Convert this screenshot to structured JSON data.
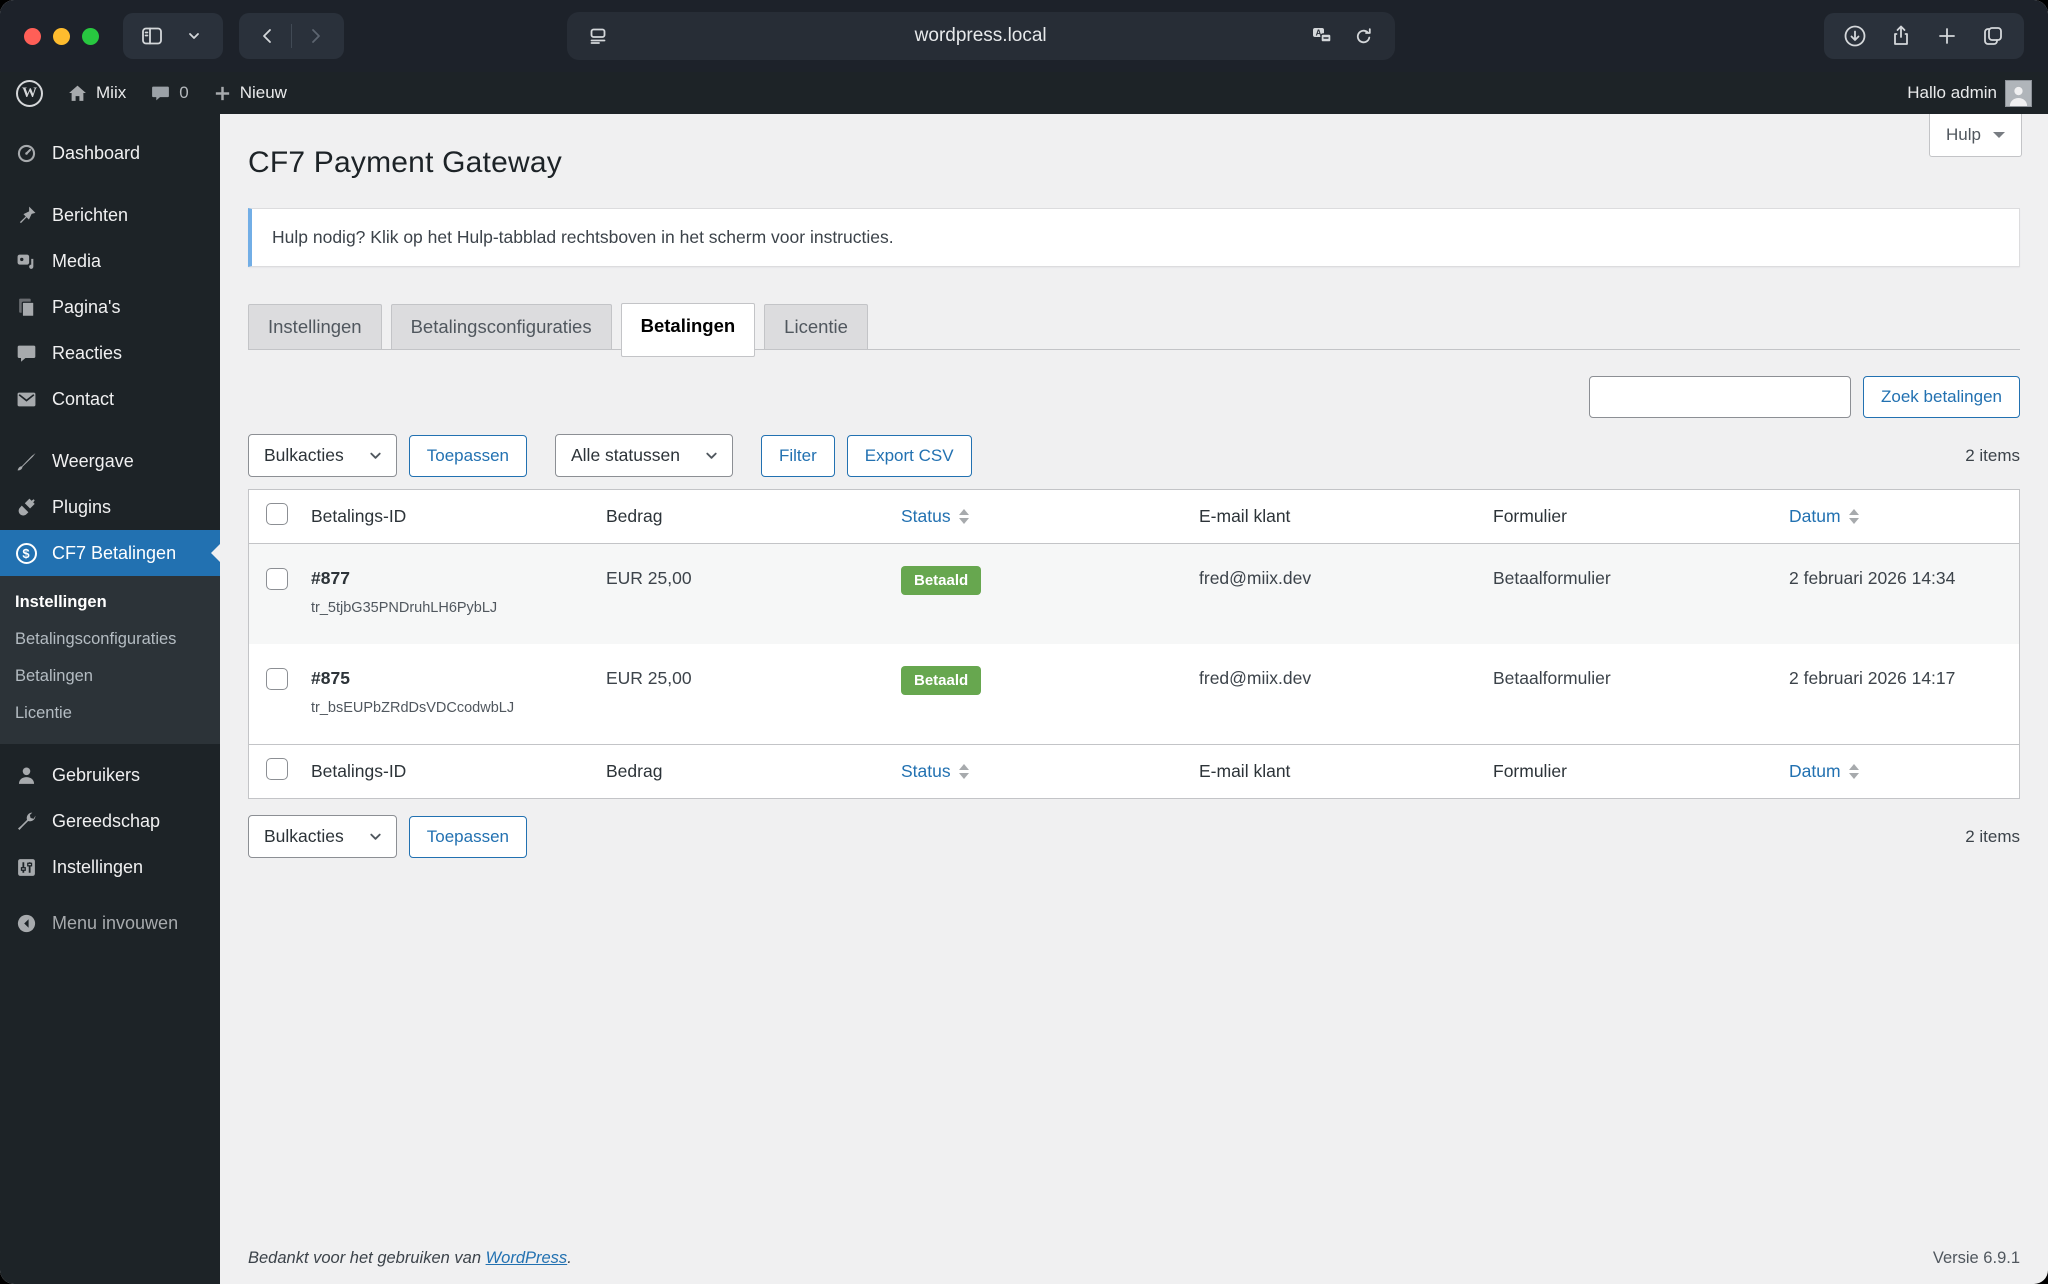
{
  "colors": {
    "accent_blue": "#2271b1",
    "badge_green": "#67a74f",
    "notice_blue": "#72aee6",
    "admin_dark": "#1d2327",
    "traffic_red": "#ff5f57",
    "traffic_yellow": "#febc2e",
    "traffic_green": "#28c840"
  },
  "icons": {
    "wp_logo_glyph": "W",
    "dollar_glyph": "$",
    "translate_glyph": "A"
  },
  "browser": {
    "url": "wordpress.local"
  },
  "admin_bar": {
    "site_name": "Miix",
    "comments_count": "0",
    "new_label": "Nieuw",
    "greeting": "Hallo admin"
  },
  "sidebar": {
    "items": [
      {
        "label": "Dashboard"
      },
      {
        "label": "Berichten"
      },
      {
        "label": "Media"
      },
      {
        "label": "Pagina's"
      },
      {
        "label": "Reacties"
      },
      {
        "label": "Contact"
      },
      {
        "label": "Weergave"
      },
      {
        "label": "Plugins"
      },
      {
        "label": "CF7 Betalingen",
        "active": true
      },
      {
        "label": "Gebruikers"
      },
      {
        "label": "Gereedschap"
      },
      {
        "label": "Instellingen"
      }
    ],
    "submenu": [
      {
        "label": "Instellingen",
        "current": true
      },
      {
        "label": "Betalingsconfiguraties"
      },
      {
        "label": "Betalingen"
      },
      {
        "label": "Licentie"
      }
    ],
    "collapse_label": "Menu invouwen"
  },
  "page": {
    "title": "CF7 Payment Gateway",
    "help_label": "Hulp",
    "notice": "Hulp nodig? Klik op het Hulp-tabblad rechtsboven in het scherm voor instructies.",
    "tabs": [
      {
        "label": "Instellingen"
      },
      {
        "label": "Betalingsconfiguraties"
      },
      {
        "label": "Betalingen",
        "active": true
      },
      {
        "label": "Licentie"
      }
    ],
    "search_button": "Zoek betalingen",
    "items_count": "2 items",
    "toolbar": {
      "bulk_actions": "Bulkacties",
      "apply": "Toepassen",
      "all_statuses": "Alle statussen",
      "filter": "Filter",
      "export_csv": "Export CSV"
    },
    "table": {
      "headers": {
        "id": "Betalings-ID",
        "amount": "Bedrag",
        "status": "Status",
        "email": "E-mail klant",
        "form": "Formulier",
        "date": "Datum"
      },
      "rows": [
        {
          "id": "#877",
          "transaction": "tr_5tjbG35PNDruhLH6PybLJ",
          "amount": "EUR 25,00",
          "status": "Betaald",
          "email": "fred@miix.dev",
          "form": "Betaalformulier",
          "date": "2 februari 2026 14:34"
        },
        {
          "id": "#875",
          "transaction": "tr_bsEUPbZRdDsVDCcodwbLJ",
          "amount": "EUR 25,00",
          "status": "Betaald",
          "email": "fred@miix.dev",
          "form": "Betaalformulier",
          "date": "2 februari 2026 14:17"
        }
      ]
    },
    "footer": {
      "thanks_prefix": "Bedankt voor het gebruiken van ",
      "link_label": "WordPress",
      "thanks_suffix": ".",
      "version": "Versie 6.9.1"
    }
  }
}
